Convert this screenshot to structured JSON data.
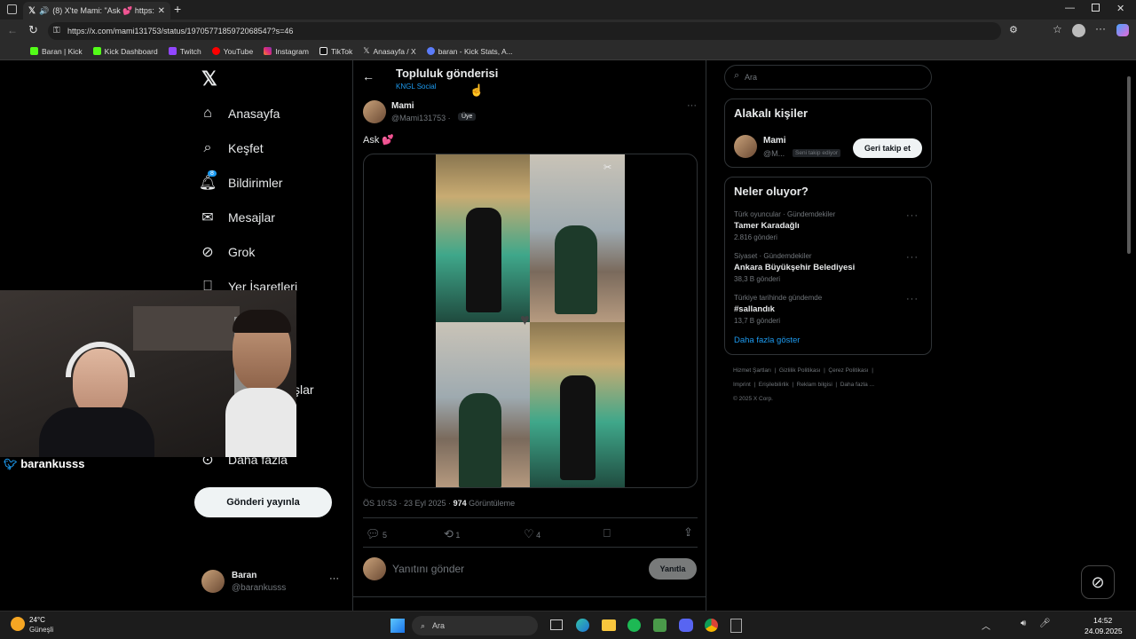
{
  "browser": {
    "tab_title": "(8) X'te Mami: \"Ask 💕 https://...",
    "url": "https://x.com/mami131753/status/1970577185972068547?s=46",
    "bookmarks": [
      "Baran | Kick",
      "Kick Dashboard",
      "Twitch",
      "YouTube",
      "Instagram",
      "TikTok",
      "Anasayfa / X",
      "baran - Kick Stats, A..."
    ]
  },
  "nav": {
    "items": [
      "Anasayfa",
      "Keşfet",
      "Bildirimler",
      "Mesajlar",
      "Grok",
      "Yer İşaretleri",
      "şlar",
      "Daha fazla"
    ],
    "notification_count": "8",
    "post_button": "Gönderi yayınla",
    "account_name": "Baran",
    "account_handle": "@barankusss"
  },
  "header": {
    "title": "Topluluk gönderisi",
    "subtitle": "KNGL Social"
  },
  "post": {
    "author": "Mami",
    "handle": "@Mami131753 ·",
    "badge": "Üye",
    "text": "Ask 💕",
    "meta_time": "ÖS 10:53 · 23 Eyl 2025 ·",
    "views": "974",
    "views_label": "Görüntüleme",
    "replies": "5",
    "reposts": "1",
    "likes": "4",
    "reply_placeholder": "Yanıtını gönder",
    "reply_button": "Yanıtla"
  },
  "search": {
    "placeholder": "Ara"
  },
  "relevant": {
    "title": "Alakalı kişiler",
    "name": "Mami",
    "handle": "@M...",
    "follows_you": "Seni takip ediyor",
    "follow_back": "Geri takip et"
  },
  "trends": {
    "title": "Neler oluyor?",
    "items": [
      {
        "context": "Türk oyuncular · Gündemdekiler",
        "name": "Tamer Karadağlı",
        "count": "2.816 gönderi"
      },
      {
        "context": "Siyaset · Gündemdekiler",
        "name": "Ankara Büyükşehir Belediyesi",
        "count": "38,3 B gönderi"
      },
      {
        "context": "Türkiye tarihinde gündemde",
        "name": "#sallandık",
        "count": "13,7 B gönderi"
      }
    ],
    "show_more": "Daha fazla göster"
  },
  "footer": {
    "links": [
      "Hizmet Şartları",
      "Gizlilik Politikası",
      "Çerez Politikası",
      "Imprint",
      "Erişilebilirlik",
      "Reklam bilgisi",
      "Daha fazla ..."
    ],
    "copyright": "© 2025 X Corp."
  },
  "overlay": {
    "streamer_name": "barankusss"
  },
  "taskbar": {
    "temp": "24°C",
    "weather": "Güneşli",
    "search_placeholder": "Ara",
    "time": "14:52",
    "date": "24.09.2025"
  }
}
